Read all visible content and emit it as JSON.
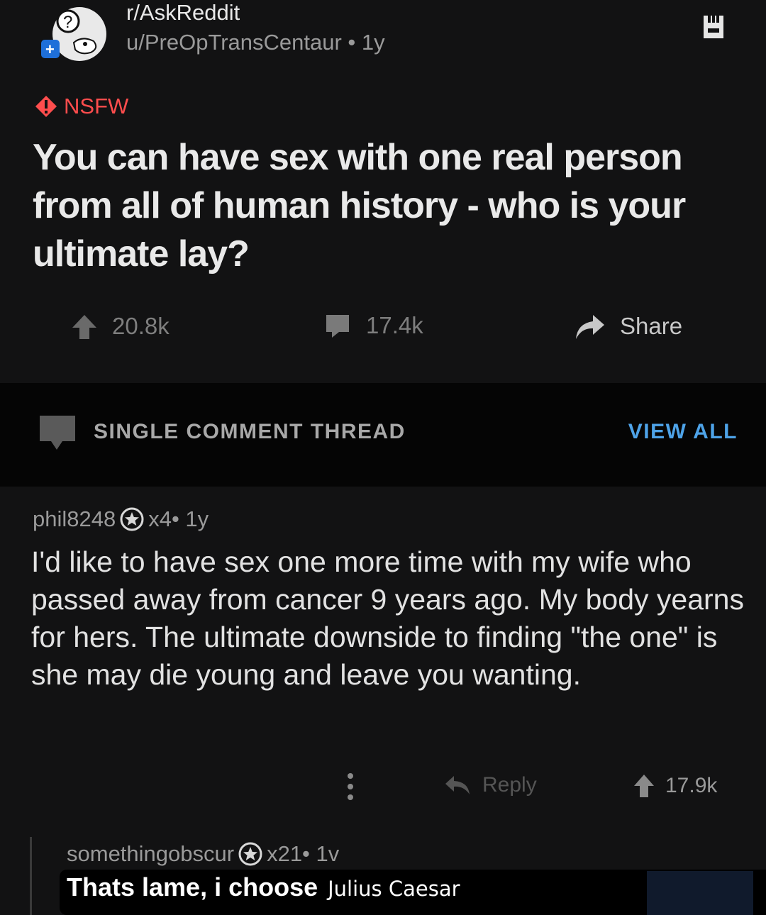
{
  "post": {
    "subreddit": "r/AskReddit",
    "meta": "u/PreOpTransCentaur • 1y",
    "nsfw_label": "NSFW",
    "title": "You can have sex with one real person from all of human history - who is your ultimate lay?",
    "upvotes": "20.8k",
    "comments": "17.4k",
    "share_label": "Share"
  },
  "thread": {
    "label": "SINGLE COMMENT THREAD",
    "view_all": "VIEW ALL"
  },
  "comment": {
    "author": "phil8248",
    "award_meta": "x4• 1y",
    "body": "I'd like to have sex one more time with my wife who passed away from cancer 9 years ago. My body yearns for hers. The ultimate downside to finding \"the one\" is she may die young and leave you wanting.",
    "reply_label": "Reply",
    "score": "17.9k"
  },
  "child": {
    "author": "somethingobscur",
    "award_meta": "x21• 1v",
    "body_bold": "Thats lame, i choose",
    "caption": "Julius Caesar"
  },
  "colors": {
    "nsfw": "#ff4d4d",
    "link": "#4ea3e8",
    "background": "#121213"
  }
}
